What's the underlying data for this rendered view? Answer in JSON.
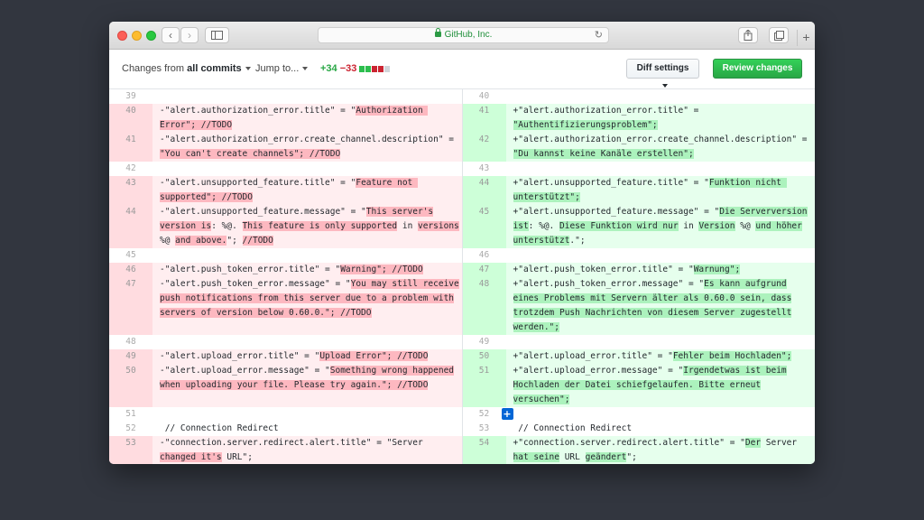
{
  "browser": {
    "url_label": "GitHub, Inc.",
    "back_glyph": "‹",
    "forward_glyph": "›",
    "new_tab_glyph": "+"
  },
  "toolbar": {
    "changes_prefix": "Changes from",
    "changes_target": "all commits",
    "jump_to": "Jump to...",
    "additions": "+34",
    "deletions": "−33",
    "diff_settings": "Diff settings",
    "review_changes": "Review changes"
  },
  "diff": {
    "rows": [
      {
        "type": "ctx",
        "ln": "39",
        "rn": "40",
        "l": "",
        "r": ""
      },
      {
        "type": "chg",
        "ln": "40",
        "rn": "41",
        "l": [
          {
            "t": "-\"alert.authorization_error.title\" = \""
          },
          {
            "t": "Authorization ",
            "h": 1
          }
        ],
        "r": [
          {
            "t": "+\"alert.authorization_error.title\" ="
          }
        ]
      },
      {
        "type": "chg",
        "ln": "",
        "rn": "",
        "l": [
          {
            "t": "Error\"; //TODO",
            "h": 1
          }
        ],
        "r": [
          {
            "t": "\"Authentifizierungsproblem\";",
            "h": 1
          }
        ]
      },
      {
        "type": "chg",
        "ln": "41",
        "rn": "42",
        "l": [
          {
            "t": "-\"alert.authorization_error.create_channel.description\" ="
          }
        ],
        "r": [
          {
            "t": "+\"alert.authorization_error.create_channel.description\" ="
          }
        ]
      },
      {
        "type": "chg",
        "ln": "",
        "rn": "",
        "l": [
          {
            "t": "\"You can't create channels\"; //TODO",
            "h": 1
          }
        ],
        "r": [
          {
            "t": "\"Du kannst keine Kanäle erstellen\";",
            "h": 1
          }
        ]
      },
      {
        "type": "ctx",
        "ln": "42",
        "rn": "43",
        "l": "",
        "r": ""
      },
      {
        "type": "chg",
        "ln": "43",
        "rn": "44",
        "l": [
          {
            "t": "-\"alert.unsupported_feature.title\" = \""
          },
          {
            "t": "Feature not ",
            "h": 1
          }
        ],
        "r": [
          {
            "t": "+\"alert.unsupported_feature.title\" = \""
          },
          {
            "t": "Funktion nicht ",
            "h": 1
          }
        ]
      },
      {
        "type": "chg",
        "ln": "",
        "rn": "",
        "l": [
          {
            "t": "supported\"; //TODO",
            "h": 1
          }
        ],
        "r": [
          {
            "t": "unterstützt\";",
            "h": 1
          }
        ]
      },
      {
        "type": "chg",
        "ln": "44",
        "rn": "45",
        "l": [
          {
            "t": "-\"alert.unsupported_feature.message\" = \""
          },
          {
            "t": "This server's",
            "h": 1
          }
        ],
        "r": [
          {
            "t": "+\"alert.unsupported_feature.message\" = \""
          },
          {
            "t": "Die Serverversion",
            "h": 1
          }
        ]
      },
      {
        "type": "chg",
        "ln": "",
        "rn": "",
        "l": [
          {
            "t": "version is",
            "h": 1
          },
          {
            "t": ": %@. "
          },
          {
            "t": "This feature is only supported",
            "h": 1
          },
          {
            "t": " in "
          },
          {
            "t": "versions",
            "h": 1
          }
        ],
        "r": [
          {
            "t": "ist",
            "h": 1
          },
          {
            "t": ": %@. "
          },
          {
            "t": "Diese Funktion wird nur",
            "h": 1
          },
          {
            "t": " in "
          },
          {
            "t": "Version",
            "h": 1
          },
          {
            "t": " %@ "
          },
          {
            "t": "und höher",
            "h": 1
          }
        ]
      },
      {
        "type": "chg",
        "ln": "",
        "rn": "",
        "l": [
          {
            "t": "%@ "
          },
          {
            "t": "and above.",
            "h": 1
          },
          {
            "t": "\"; "
          },
          {
            "t": "//TODO",
            "h": 1
          }
        ],
        "r": [
          {
            "t": "unterstützt",
            "h": 1
          },
          {
            "t": ".\";"
          }
        ]
      },
      {
        "type": "ctx",
        "ln": "45",
        "rn": "46",
        "l": "",
        "r": ""
      },
      {
        "type": "chg",
        "ln": "46",
        "rn": "47",
        "l": [
          {
            "t": "-\"alert.push_token_error.title\" = \""
          },
          {
            "t": "Warning\"; //TODO",
            "h": 1
          }
        ],
        "r": [
          {
            "t": "+\"alert.push_token_error.title\" = \""
          },
          {
            "t": "Warnung\";",
            "h": 1
          }
        ]
      },
      {
        "type": "chg",
        "ln": "47",
        "rn": "48",
        "l": [
          {
            "t": "-\"alert.push_token_error.message\" = \""
          },
          {
            "t": "You may still receive",
            "h": 1
          }
        ],
        "r": [
          {
            "t": "+\"alert.push_token_error.message\" = \""
          },
          {
            "t": "Es kann aufgrund",
            "h": 1
          }
        ]
      },
      {
        "type": "chg",
        "ln": "",
        "rn": "",
        "l": [
          {
            "t": "push notifications from this server due to a problem with",
            "h": 1
          }
        ],
        "r": [
          {
            "t": "eines Problems mit Servern älter als 0.60.0 sein, dass",
            "h": 1
          }
        ]
      },
      {
        "type": "chg",
        "ln": "",
        "rn": "",
        "l": [
          {
            "t": "servers of version below 0.60.0.\"; //TODO",
            "h": 1
          }
        ],
        "r": [
          {
            "t": "trotzdem Push Nachrichten von diesem Server zugestellt",
            "h": 1
          }
        ]
      },
      {
        "type": "chg",
        "ln": "",
        "rn": "",
        "l": [],
        "r": [
          {
            "t": "werden.\";",
            "h": 1
          }
        ]
      },
      {
        "type": "ctx",
        "ln": "48",
        "rn": "49",
        "l": "",
        "r": ""
      },
      {
        "type": "chg",
        "ln": "49",
        "rn": "50",
        "l": [
          {
            "t": "-\"alert.upload_error.title\" = \""
          },
          {
            "t": "Upload Error\"; //TODO",
            "h": 1
          }
        ],
        "r": [
          {
            "t": "+\"alert.upload_error.title\" = \""
          },
          {
            "t": "Fehler beim Hochladen\";",
            "h": 1
          }
        ]
      },
      {
        "type": "chg",
        "ln": "50",
        "rn": "51",
        "l": [
          {
            "t": "-\"alert.upload_error.message\" = \""
          },
          {
            "t": "Something wrong happened",
            "h": 1
          }
        ],
        "r": [
          {
            "t": "+\"alert.upload_error.message\" = \""
          },
          {
            "t": "Irgendetwas ist beim",
            "h": 1
          }
        ]
      },
      {
        "type": "chg",
        "ln": "",
        "rn": "",
        "l": [
          {
            "t": "when uploading your file. Please try again.\"; //TODO",
            "h": 1
          }
        ],
        "r": [
          {
            "t": "Hochladen der Datei schiefgelaufen. Bitte erneut",
            "h": 1
          }
        ]
      },
      {
        "type": "chg",
        "ln": "",
        "rn": "",
        "l": [],
        "r": [
          {
            "t": "versuchen\";",
            "h": 1
          }
        ]
      },
      {
        "type": "ctx",
        "ln": "51",
        "rn": "52",
        "l": "",
        "r": "",
        "plus": true
      },
      {
        "type": "ctx",
        "ln": "52",
        "rn": "53",
        "l": " // Connection Redirect",
        "r": " // Connection Redirect"
      },
      {
        "type": "chg",
        "ln": "53",
        "rn": "54",
        "l": [
          {
            "t": "-\"connection.server.redirect.alert.title\" = \"Server"
          }
        ],
        "r": [
          {
            "t": "+\"connection.server.redirect.alert.title\" = \""
          },
          {
            "t": "Der",
            "h": 1
          },
          {
            "t": " Server"
          }
        ]
      },
      {
        "type": "chg",
        "ln": "",
        "rn": "",
        "l": [
          {
            "t": "changed it's",
            "h": 1
          },
          {
            "t": " URL\";"
          }
        ],
        "r": [
          {
            "t": "hat seine",
            "h": 1
          },
          {
            "t": " URL "
          },
          {
            "t": "geändert",
            "h": 1
          },
          {
            "t": "\";"
          }
        ]
      }
    ]
  }
}
